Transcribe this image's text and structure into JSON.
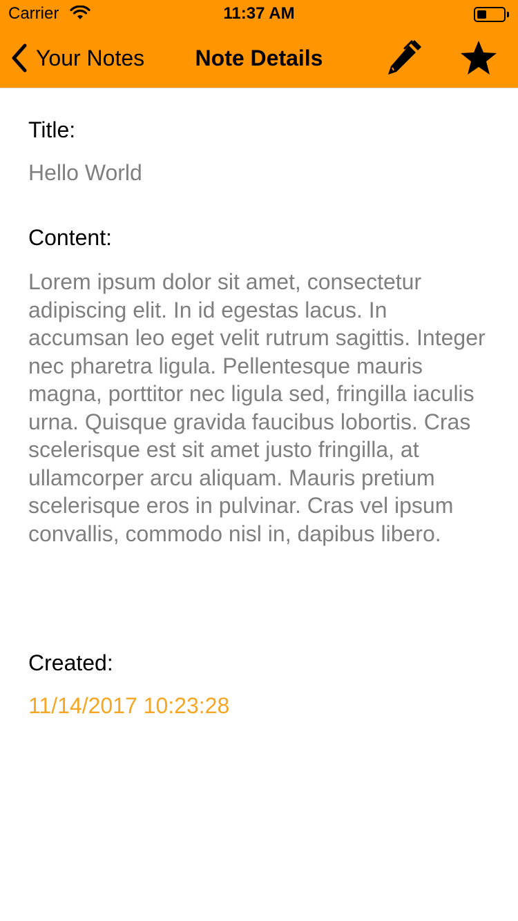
{
  "status_bar": {
    "carrier": "Carrier",
    "time": "11:37 AM",
    "battery_level": 0.35
  },
  "nav_bar": {
    "back_label": "Your Notes",
    "title": "Note Details",
    "edit_icon": "pencil-icon",
    "favorite_icon": "star-icon"
  },
  "note": {
    "title_label": "Title:",
    "title_value": "Hello World",
    "content_label": "Content:",
    "content_value": "Lorem ipsum dolor sit amet, consectetur adipiscing elit. In id egestas lacus. In accumsan leo eget velit rutrum sagittis. Integer nec pharetra ligula. Pellentesque mauris magna, porttitor nec ligula sed, fringilla iaculis urna. Quisque gravida faucibus lobortis. Cras scelerisque est sit amet justo fringilla, at ullamcorper arcu aliquam. Mauris pretium scelerisque eros in pulvinar. Cras vel ipsum convallis, commodo nisl in, dapibus libero.",
    "created_label": "Created:",
    "created_value": "11/14/2017 10:23:28"
  },
  "colors": {
    "accent": "#ff9500",
    "secondary_text": "#7f7f7f",
    "created_text": "#f5a623"
  }
}
